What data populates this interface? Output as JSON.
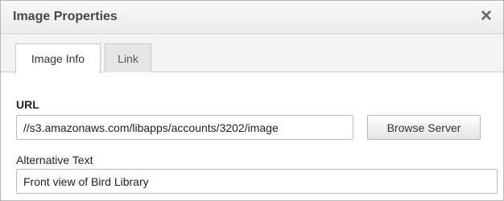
{
  "dialog": {
    "title": "Image Properties",
    "close_glyph": "✕"
  },
  "tabs": [
    {
      "label": "Image Info",
      "active": true
    },
    {
      "label": "Link",
      "active": false
    }
  ],
  "form": {
    "url_label": "URL",
    "url_value": "//s3.amazonaws.com/libapps/accounts/3202/image",
    "browse_label": "Browse Server",
    "alt_label": "Alternative Text",
    "alt_value": "Front view of Bird Library"
  }
}
